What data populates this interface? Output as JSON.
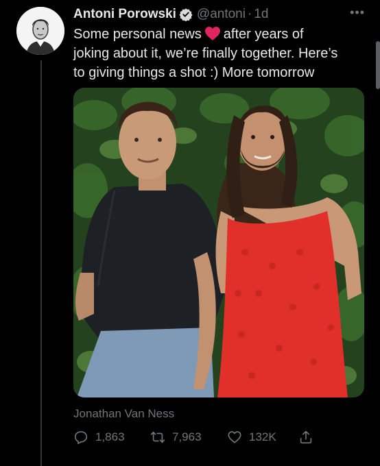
{
  "tweet": {
    "author_name": "Antoni Porowski",
    "handle": "@antoni",
    "separator": "·",
    "time": "1d",
    "text_line1_before": "Some personal news",
    "text_line1_after": "after years of",
    "text_line2": "joking about it, we’re finally together. Here’s",
    "text_line3": "to giving things a shot :) More tomorrow",
    "tagged_user": "Jonathan Van Ness"
  },
  "actions": {
    "replies": "1,863",
    "retweets": "7,963",
    "likes": "132K"
  },
  "colors": {
    "background": "#000000",
    "text": "#e7e9ea",
    "muted": "#71767b",
    "verified": "#d9d9d9",
    "heart": "#e0245e"
  },
  "icons": [
    "verified-badge-icon",
    "heart-emoji-icon",
    "more-icon",
    "reply-icon",
    "retweet-icon",
    "like-icon",
    "share-icon"
  ]
}
